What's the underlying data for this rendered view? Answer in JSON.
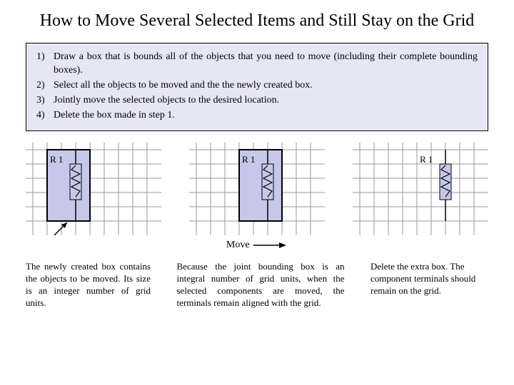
{
  "title": "How to Move Several Selected Items and Still Stay on the Grid",
  "steps": [
    "Draw a box that is bounds all of the objects that you need to move (including their complete bounding boxes).",
    "Select all the objects to be moved and the the newly created box.",
    "Jointly move the selected objects to the desired location.",
    "Delete the box made in step 1."
  ],
  "label_r1": "R 1",
  "move_label": "Move",
  "captions": {
    "c1": "The newly created box contains the objects to be moved. Its size is an integer number of grid units.",
    "c2": "Because the joint bounding box is an integral number of grid units, when the selected components are moved, the terminals remain aligned with the grid.",
    "c3": "Delete the extra box. The component terminals should remain on the grid."
  },
  "colors": {
    "box_fill": "#c5c8e8",
    "grid": "#888888",
    "resistor_fill": "#c5c8e8"
  }
}
